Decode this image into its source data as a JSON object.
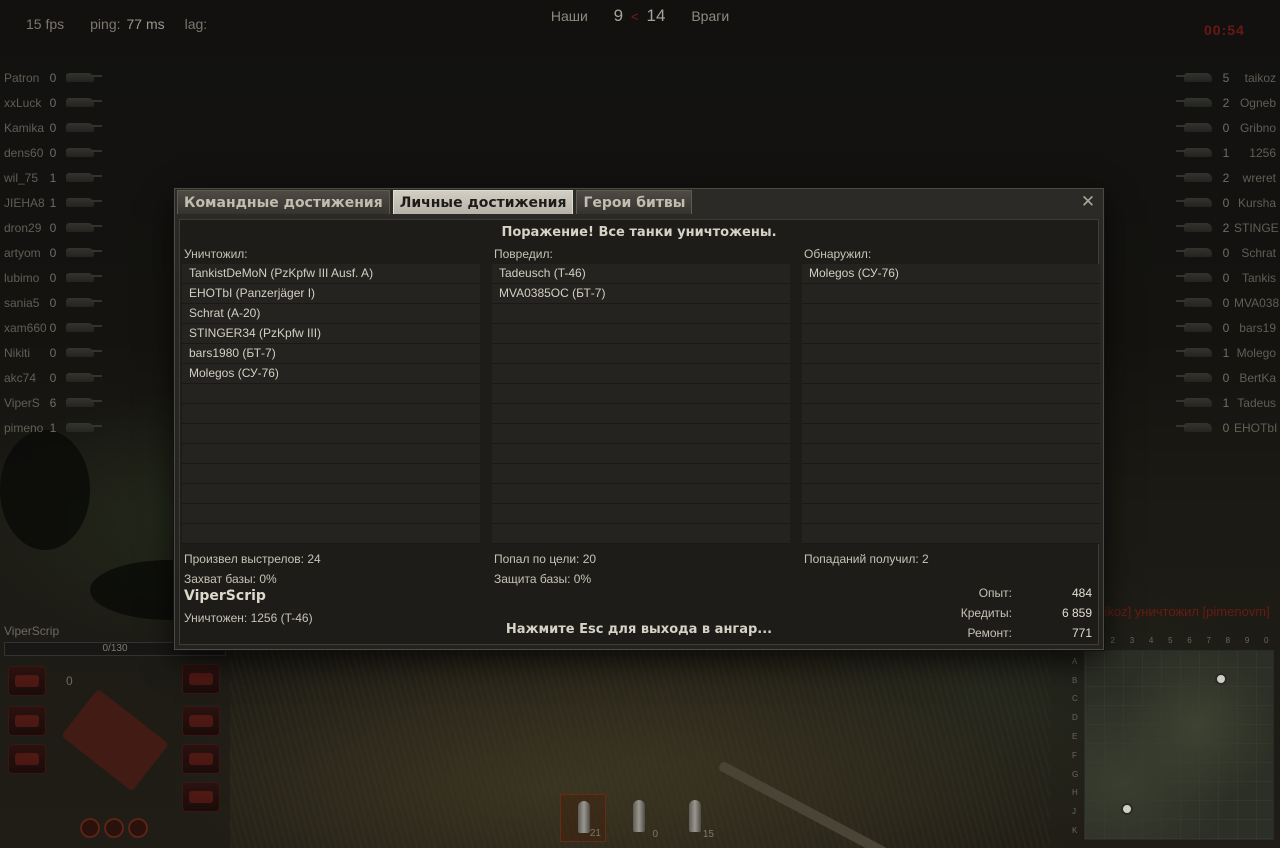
{
  "hud": {
    "fps": "15 fps",
    "ping_label": "ping:",
    "ping_value": "77 ms",
    "lag_label": "lag:",
    "ours_label": "Наши",
    "ours_score": "9",
    "score_sep": "<",
    "enemy_score": "14",
    "enemy_label": "Враги",
    "timer": "00:54"
  },
  "allies": [
    {
      "name": "Patron",
      "frags": "0"
    },
    {
      "name": "xxLuck",
      "frags": "0"
    },
    {
      "name": "Kamika",
      "frags": "0"
    },
    {
      "name": "dens60",
      "frags": "0"
    },
    {
      "name": "wil_75",
      "frags": "1"
    },
    {
      "name": "JIEHA8",
      "frags": "1"
    },
    {
      "name": "dron29",
      "frags": "0"
    },
    {
      "name": "artyom",
      "frags": "0"
    },
    {
      "name": "lubimo",
      "frags": "0"
    },
    {
      "name": "sania5",
      "frags": "0"
    },
    {
      "name": "xam660",
      "frags": "0"
    },
    {
      "name": "Nikiti",
      "frags": "0"
    },
    {
      "name": "akc74",
      "frags": "0"
    },
    {
      "name": "ViperS",
      "frags": "6"
    },
    {
      "name": "pimeno",
      "frags": "1"
    }
  ],
  "enemies": [
    {
      "name": "taikoz",
      "frags": "5"
    },
    {
      "name": "Ogneb",
      "frags": "2"
    },
    {
      "name": "Gribno",
      "frags": "0"
    },
    {
      "name": "1256",
      "frags": "1"
    },
    {
      "name": "wreret",
      "frags": "2"
    },
    {
      "name": "Kursha",
      "frags": "0"
    },
    {
      "name": "STINGE",
      "frags": "2"
    },
    {
      "name": "Schrat",
      "frags": "0"
    },
    {
      "name": "Tankis",
      "frags": "0"
    },
    {
      "name": "MVA038",
      "frags": "0"
    },
    {
      "name": "bars19",
      "frags": "0"
    },
    {
      "name": "Molego",
      "frags": "1"
    },
    {
      "name": "BertKa",
      "frags": "0"
    },
    {
      "name": "Tadeus",
      "frags": "1"
    },
    {
      "name": "EHOTbI",
      "frags": "0"
    }
  ],
  "kill_message": "[taikoz] уничтожил [pimenovm]",
  "damage_panel": {
    "player": "ViperScrip",
    "hp": "0/130",
    "speed": "0"
  },
  "ammo": [
    {
      "count": "21",
      "selected": true
    },
    {
      "count": "0",
      "selected": false
    },
    {
      "count": "15",
      "selected": false
    }
  ],
  "minimap": {
    "cols": [
      "1",
      "2",
      "3",
      "4",
      "5",
      "6",
      "7",
      "8",
      "9",
      "0"
    ],
    "rows": [
      "A",
      "B",
      "C",
      "D",
      "E",
      "F",
      "G",
      "H",
      "J",
      "K"
    ]
  },
  "dialog": {
    "tabs": [
      "Командные достижения",
      "Личные достижения",
      "Герои битвы"
    ],
    "active_tab": 1,
    "close_symbol": "✕",
    "result_title": "Поражение! Все танки уничтожены.",
    "destroyed": {
      "header": "Уничтожил:",
      "items": [
        "TankistDeMoN (PzKpfw III Ausf. A)",
        "EHOTbI (Panzerjäger I)",
        "Schrat (A-20)",
        "STINGER34 (PzKpfw III)",
        "bars1980 (БТ-7)",
        "Molegos (СУ-76)"
      ]
    },
    "damaged": {
      "header": "Повредил:",
      "items": [
        "Tadeusch (T-46)",
        "MVA0385OC (БТ-7)"
      ]
    },
    "spotted": {
      "header": "Обнаружил:",
      "items": [
        "Molegos (СУ-76)"
      ]
    },
    "stats": {
      "shots": "Произвел выстрелов: 24",
      "hits": "Попал по цели: 20",
      "received": "Попаданий получил: 2",
      "capture": "Захват базы: 0%",
      "defense": "Защита базы: 0%"
    },
    "player_name": "ViperScrip",
    "killed_by": "Уничтожен: 1256 (T-46)",
    "exit_hint": "Нажмите Esc для выхода в ангар...",
    "rewards": [
      {
        "label": "Опыт:",
        "value": "484"
      },
      {
        "label": "Кредиты:",
        "value": "6 859"
      },
      {
        "label": "Ремонт:",
        "value": "771"
      }
    ]
  }
}
